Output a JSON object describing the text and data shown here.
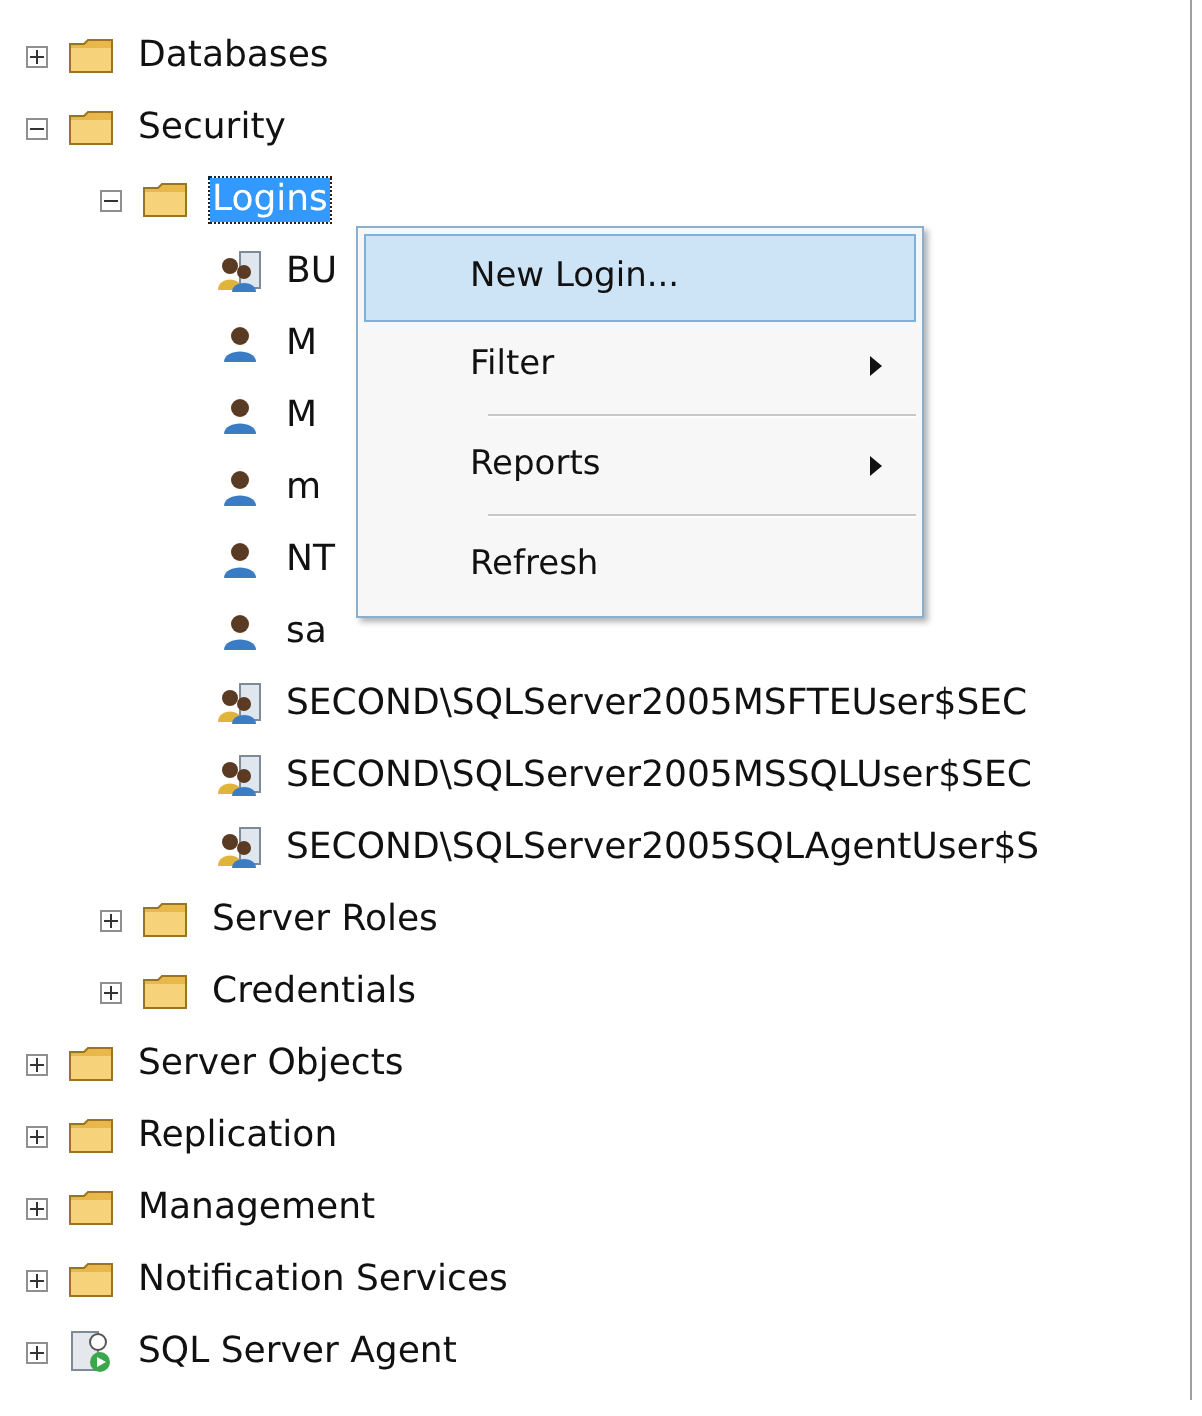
{
  "tree": [
    {
      "label": "Databases",
      "kind": "folder",
      "expanded": false,
      "selected": false
    },
    {
      "label": "Security",
      "kind": "folder",
      "expanded": true,
      "selected": false,
      "children": [
        {
          "label": "Logins",
          "kind": "folder",
          "expanded": true,
          "selected": true,
          "children": [
            {
              "label": "BU",
              "kind": "group",
              "selected": false
            },
            {
              "label": "M",
              "kind": "user",
              "selected": false
            },
            {
              "label": "M",
              "kind": "user",
              "selected": false
            },
            {
              "label": "m",
              "kind": "user",
              "selected": false
            },
            {
              "label": "NT",
              "kind": "user",
              "selected": false
            },
            {
              "label": "sa",
              "kind": "user",
              "selected": false
            },
            {
              "label": "SECOND\\SQLServer2005MSFTEUser$SEC",
              "kind": "group",
              "selected": false
            },
            {
              "label": "SECOND\\SQLServer2005MSSQLUser$SEC",
              "kind": "group",
              "selected": false
            },
            {
              "label": "SECOND\\SQLServer2005SQLAgentUser$S",
              "kind": "group",
              "selected": false
            }
          ]
        },
        {
          "label": "Server Roles",
          "kind": "folder",
          "expanded": false,
          "selected": false
        },
        {
          "label": "Credentials",
          "kind": "folder",
          "expanded": false,
          "selected": false
        }
      ]
    },
    {
      "label": "Server Objects",
      "kind": "folder",
      "expanded": false,
      "selected": false
    },
    {
      "label": "Replication",
      "kind": "folder",
      "expanded": false,
      "selected": false
    },
    {
      "label": "Management",
      "kind": "folder",
      "expanded": false,
      "selected": false
    },
    {
      "label": "Notification Services",
      "kind": "folder",
      "expanded": false,
      "selected": false
    },
    {
      "label": "SQL Server Agent",
      "kind": "agent",
      "expanded": false,
      "selected": false
    }
  ],
  "context_menu": [
    {
      "kind": "item",
      "label": "New Login...",
      "highlighted": true,
      "submenu": false
    },
    {
      "kind": "item",
      "label": "Filter",
      "highlighted": false,
      "submenu": true
    },
    {
      "kind": "separator"
    },
    {
      "kind": "item",
      "label": "Reports",
      "highlighted": false,
      "submenu": true
    },
    {
      "kind": "separator"
    },
    {
      "kind": "item",
      "label": "Refresh",
      "highlighted": false,
      "submenu": false
    }
  ]
}
